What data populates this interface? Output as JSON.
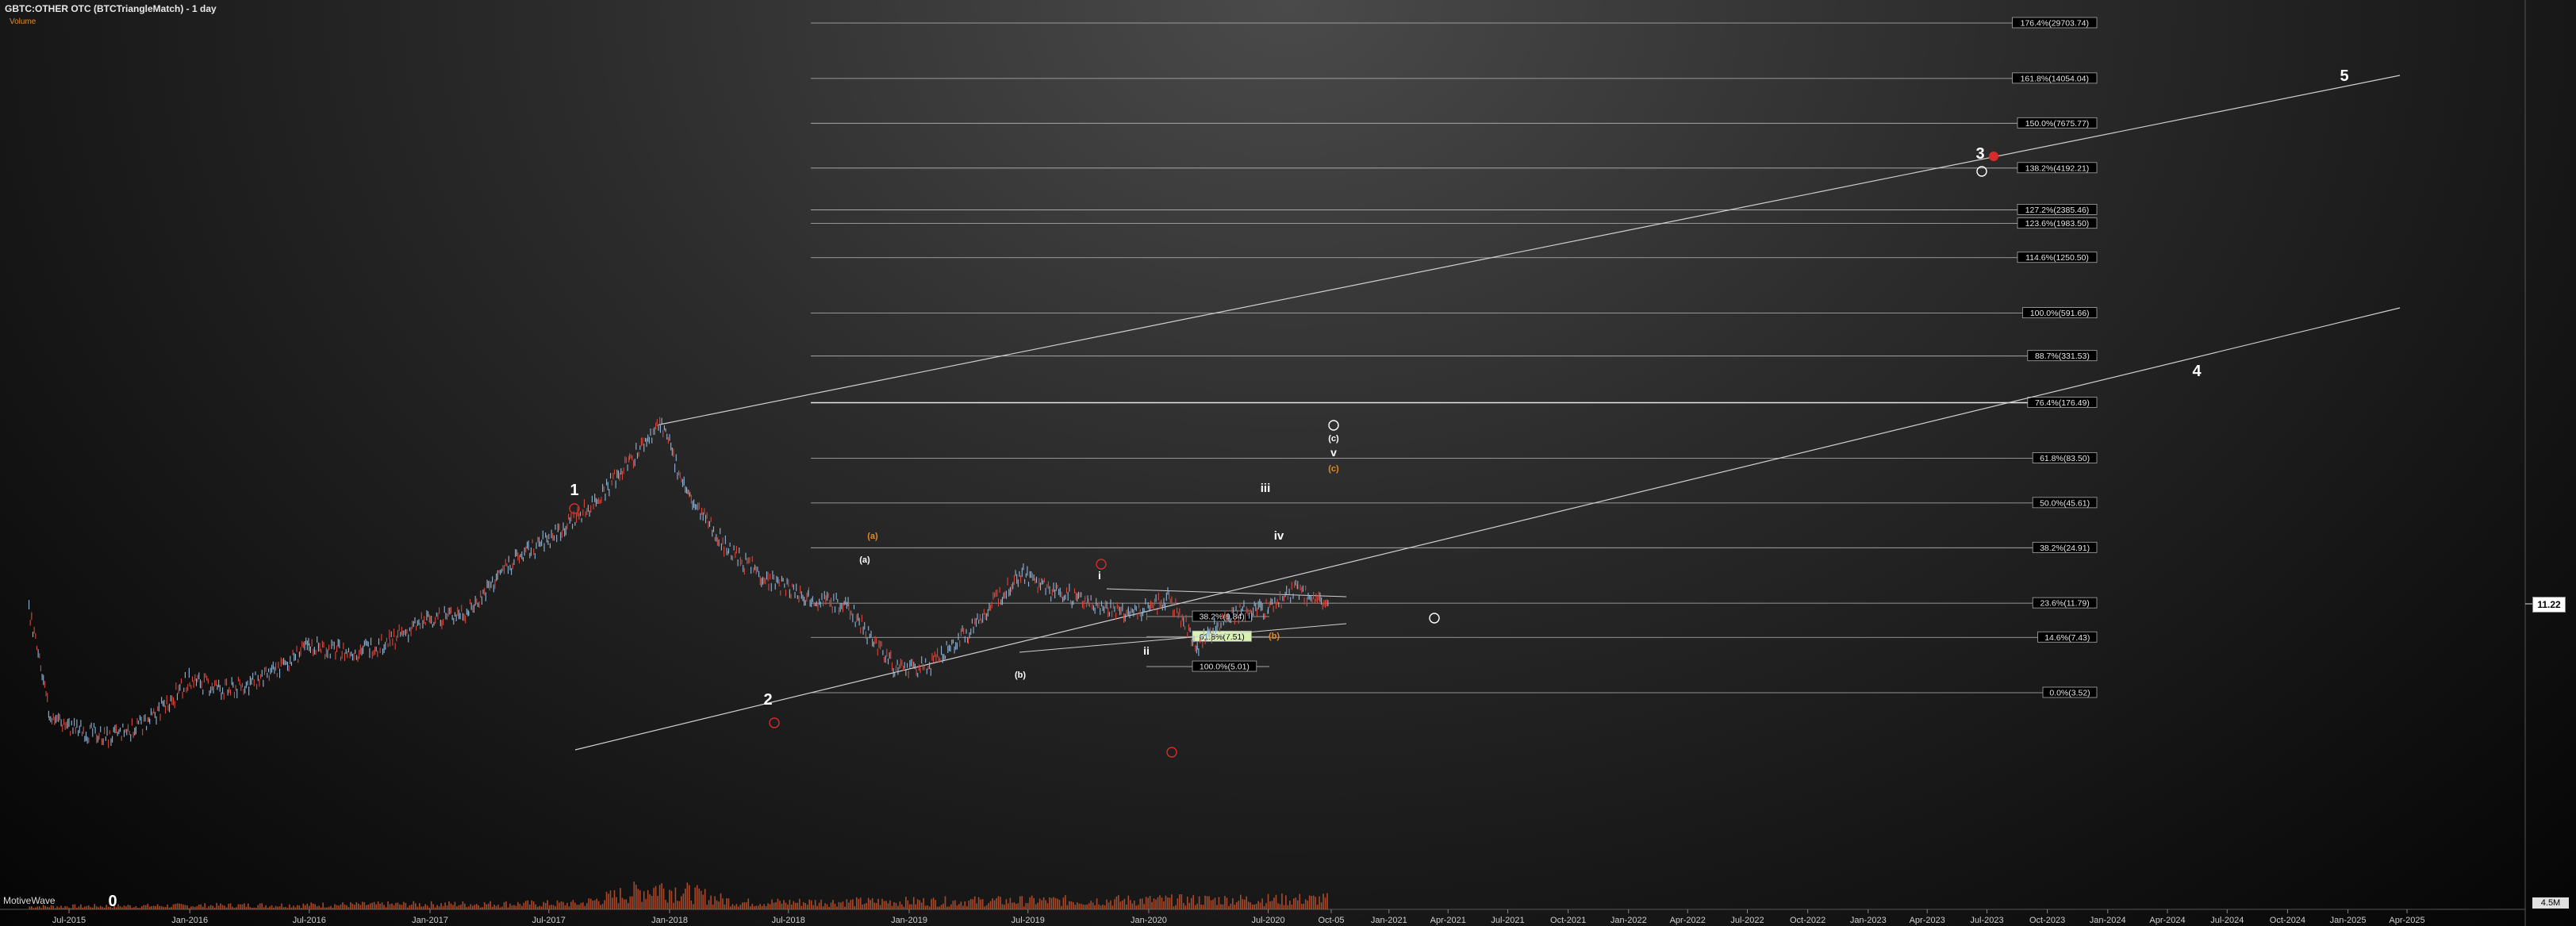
{
  "header": {
    "title": "GBTC:OTHER OTC (BTCTriangleMatch) - 1 day",
    "subtitle": "Volume"
  },
  "watermark": "MotiveWave",
  "price_tag": "11.22",
  "volume_tag": "4.5M",
  "colors": {
    "bar_up": "#8fb4d6",
    "bar_down": "#d8463c",
    "volume": "#c2532f",
    "fib_line": "#b8b8b8",
    "trend_line": "#d0d0d0",
    "label_orange": "#e08a2a",
    "label_red": "#d92b2b",
    "highlight_fib": "#d9f2b4"
  },
  "chart_data": {
    "type": "line",
    "title": "GBTC:OTHER OTC (BTCTriangleMatch) - 1 day",
    "y_scale": "log",
    "x_ticks": [
      "Jul-2015",
      "Jan-2016",
      "Jul-2016",
      "Jan-2017",
      "Jul-2017",
      "Jan-2018",
      "Jul-2018",
      "Jan-2019",
      "Jul-2019",
      "Jan-2020",
      "Jul-2020",
      "Oct-05",
      "Jan-2021",
      "Apr-2021",
      "Jul-2021",
      "Oct-2021",
      "Jan-2022",
      "Apr-2022",
      "Jul-2022",
      "Oct-2022",
      "Jan-2023",
      "Apr-2023",
      "Jul-2023",
      "Oct-2023",
      "Jan-2024",
      "Apr-2024",
      "Jul-2024",
      "Oct-2024",
      "Jan-2025",
      "Apr-2025"
    ],
    "series": [
      {
        "values": [
          [
            "2015-05-01",
            11.0
          ],
          [
            "2015-06-01",
            2.6
          ],
          [
            "2015-07-01",
            2.2
          ],
          [
            "2015-09-01",
            1.9
          ],
          [
            "2015-11-01",
            2.4
          ],
          [
            "2016-01-01",
            4.2
          ],
          [
            "2016-03-01",
            3.6
          ],
          [
            "2016-05-01",
            4.4
          ],
          [
            "2016-07-01",
            6.6
          ],
          [
            "2016-09-01",
            6.0
          ],
          [
            "2016-11-01",
            7.0
          ],
          [
            "2017-01-01",
            9.5
          ],
          [
            "2017-03-01",
            10.5
          ],
          [
            "2017-05-01",
            20.0
          ],
          [
            "2017-07-01",
            28.0
          ],
          [
            "2017-09-01",
            43.0
          ],
          [
            "2017-11-01",
            80.0
          ],
          [
            "2017-12-18",
            133.0
          ],
          [
            "2018-02-01",
            48.0
          ],
          [
            "2018-04-01",
            24.0
          ],
          [
            "2018-06-01",
            16.0
          ],
          [
            "2018-08-01",
            13.0
          ],
          [
            "2018-10-01",
            11.0
          ],
          [
            "2018-12-15",
            4.7
          ],
          [
            "2019-02-01",
            5.0
          ],
          [
            "2019-04-01",
            8.0
          ],
          [
            "2019-06-20",
            18.0
          ],
          [
            "2019-08-01",
            14.0
          ],
          [
            "2019-10-01",
            12.0
          ],
          [
            "2019-12-01",
            10.0
          ],
          [
            "2020-02-01",
            12.5
          ],
          [
            "2020-03-15",
            6.6
          ],
          [
            "2020-05-01",
            10.0
          ],
          [
            "2020-07-01",
            11.0
          ],
          [
            "2020-08-15",
            14.0
          ],
          [
            "2020-10-01",
            11.22
          ]
        ]
      }
    ],
    "volume_series": "daily volume bars, 2015-05 to 2020-10, peak near 2017-12",
    "fib_levels": [
      {
        "label": "176.4%(29703.74)",
        "value": 29703.74
      },
      {
        "label": "161.8%(14054.04)",
        "value": 14054.04
      },
      {
        "label": "150.0%(7675.77)",
        "value": 7675.77
      },
      {
        "label": "138.2%(4192.21)",
        "value": 4192.21
      },
      {
        "label": "127.2%(2385.46)",
        "value": 2385.46
      },
      {
        "label": "123.6%(1983.50)",
        "value": 1983.5
      },
      {
        "label": "114.6%(1250.50)",
        "value": 1250.5
      },
      {
        "label": "100.0%(591.66)",
        "value": 591.66
      },
      {
        "label": "88.7%(331.53)",
        "value": 331.53
      },
      {
        "label": "76.4%(176.49)",
        "value": 176.49
      },
      {
        "label": "61.8%(83.50)",
        "value": 83.5
      },
      {
        "label": "50.0%(45.61)",
        "value": 45.61
      },
      {
        "label": "38.2%(24.91)",
        "value": 24.91
      },
      {
        "label": "23.6%(11.79)",
        "value": 11.79
      },
      {
        "label": "14.6%(7.43)",
        "value": 7.43
      },
      {
        "label": "0.0%(3.52)",
        "value": 3.52
      }
    ],
    "short_fib_levels": [
      {
        "label": "38.2%(9.84)",
        "value": 9.84
      },
      {
        "label": "61.8%(7.51)",
        "value": 7.51,
        "highlight": true
      },
      {
        "label": "100.0%(5.01)",
        "value": 5.01
      }
    ],
    "wave_labels": [
      "0",
      "1",
      "2",
      "3",
      "4",
      "5",
      "i",
      "ii",
      "iii",
      "iv",
      "v",
      "(a)",
      "(b)",
      "(c)",
      "(a)",
      "(b)",
      "(c)"
    ]
  }
}
